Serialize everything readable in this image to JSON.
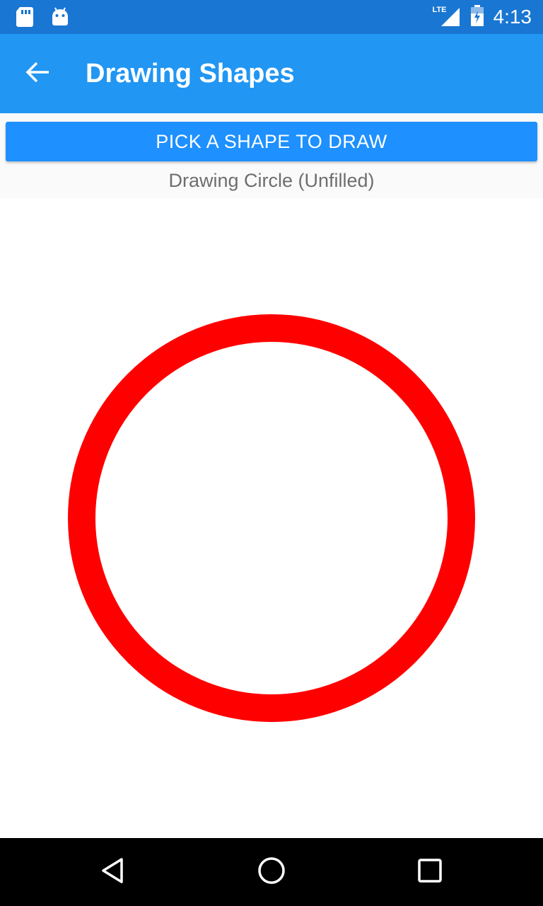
{
  "status_bar": {
    "time": "4:13",
    "network_label": "LTE",
    "icons": [
      "sd-card-icon",
      "android-icon",
      "lte-signal-icon",
      "battery-icon"
    ]
  },
  "app_bar": {
    "title": "Drawing Shapes",
    "back_icon": "arrow-back-icon"
  },
  "controls": {
    "pick_button_label": "PICK A SHAPE TO DRAW",
    "status_text": "Drawing Circle (Unfilled)"
  },
  "drawing": {
    "shape": "circle",
    "filled": false,
    "stroke_color": "#ff0000"
  },
  "nav_bar": {
    "icons": [
      "back-triangle-icon",
      "home-circle-icon",
      "recents-square-icon"
    ]
  },
  "colors": {
    "status_bar": "#1976d2",
    "app_bar": "#2196f3",
    "button": "#1e90ff",
    "nav_bar": "#000000"
  }
}
